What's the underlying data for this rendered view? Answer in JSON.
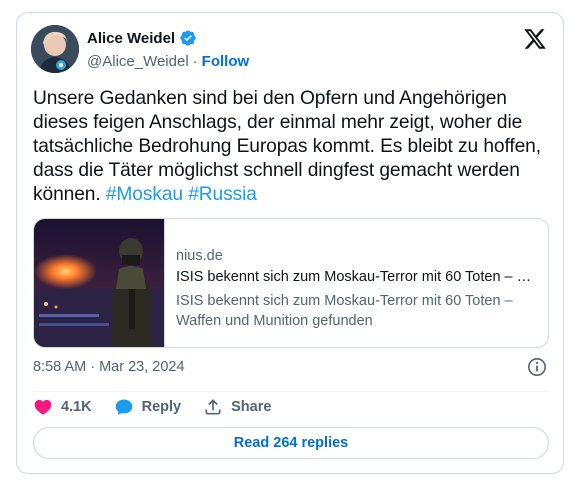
{
  "author": {
    "name": "Alice Weidel",
    "handle": "@Alice_Weidel",
    "separator": "·",
    "follow_label": "Follow",
    "verified": true
  },
  "tweet": {
    "text": "Unsere Gedanken sind bei den Opfern und Angehörigen dieses feigen Anschlags, der einmal mehr zeigt, woher die tatsächliche Bedrohung Europas kommt. Es bleibt zu hoffen, dass die Täter möglichst schnell dingfest gemacht werden können.",
    "hashtags": [
      "#Moskau",
      "#Russia"
    ]
  },
  "link_card": {
    "domain": "nius.de",
    "title": "ISIS bekennt sich zum Moskau-Terror mit 60 Toten – Waffen und Munition gefunden",
    "description": "ISIS bekennt sich zum Moskau-Terror mit 60 Toten – Waffen und Munition gefunden"
  },
  "timestamp": "8:58 AM · Mar 23, 2024",
  "actions": {
    "like_count": "4.1K",
    "reply_label": "Reply",
    "share_label": "Share"
  },
  "replies_button": "Read 264 replies",
  "colors": {
    "like": "#f91880",
    "link": "#006fd6",
    "hashtag": "#1d9bf0",
    "verified": "#1d9bf0",
    "reply_icon": "#1d9bf0",
    "secondary_text": "#536471"
  },
  "icons": {
    "verified": "verified-badge-icon",
    "x_logo": "x-logo-icon",
    "info": "info-icon",
    "like": "heart-icon",
    "reply": "speech-bubble-icon",
    "share": "share-upload-icon"
  }
}
